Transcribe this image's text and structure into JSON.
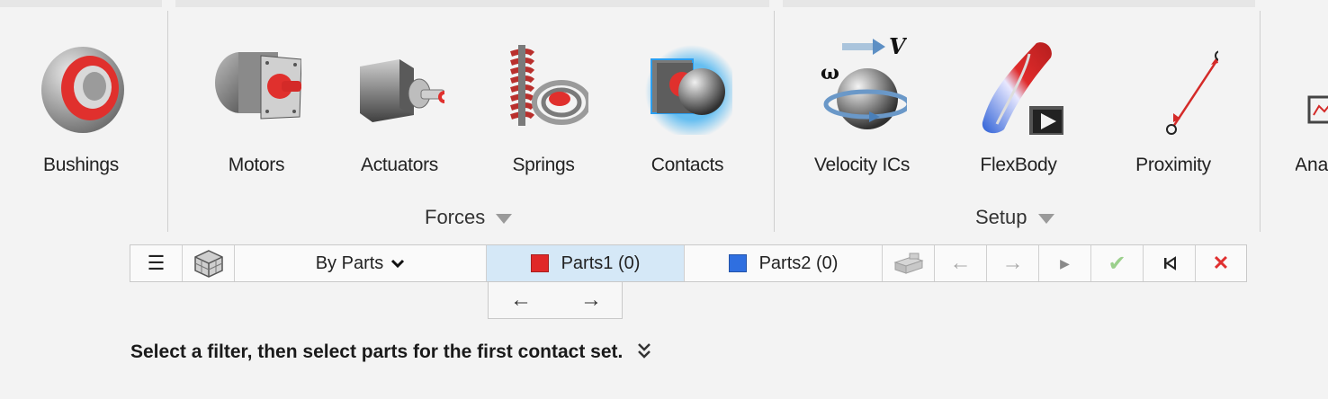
{
  "ribbon": {
    "tools": [
      {
        "name": "bushings",
        "label": "Bushings"
      },
      {
        "name": "motors",
        "label": "Motors"
      },
      {
        "name": "actuators",
        "label": "Actuators"
      },
      {
        "name": "springs",
        "label": "Springs"
      },
      {
        "name": "contacts",
        "label": "Contacts"
      },
      {
        "name": "velocity-ics",
        "label": "Velocity ICs"
      },
      {
        "name": "flexbody",
        "label": "FlexBody"
      },
      {
        "name": "proximity",
        "label": "Proximity"
      },
      {
        "name": "analysis",
        "label": "Ana"
      }
    ],
    "groups": {
      "forces": "Forces",
      "setup": "Setup"
    },
    "velocity_symbols": {
      "omega": "ω",
      "v": "V"
    }
  },
  "guidebar": {
    "menu_glyph": "☰",
    "filter_label": "By Parts",
    "parts1_label": "Parts1 (0)",
    "parts2_label": "Parts2 (0)",
    "parts1_color": "#e02828",
    "parts2_color": "#2f6fe0",
    "back_glyph": "←",
    "next_glyph": "→",
    "play_glyph": "▶",
    "apply_glyph": "✔",
    "first_glyph": "⏮",
    "close_glyph": "✕",
    "sub_back_glyph": "←",
    "sub_next_glyph": "→"
  },
  "status": {
    "message": "Select a filter, then select parts for the first contact set.",
    "expand_glyph": "⌄⌄"
  }
}
